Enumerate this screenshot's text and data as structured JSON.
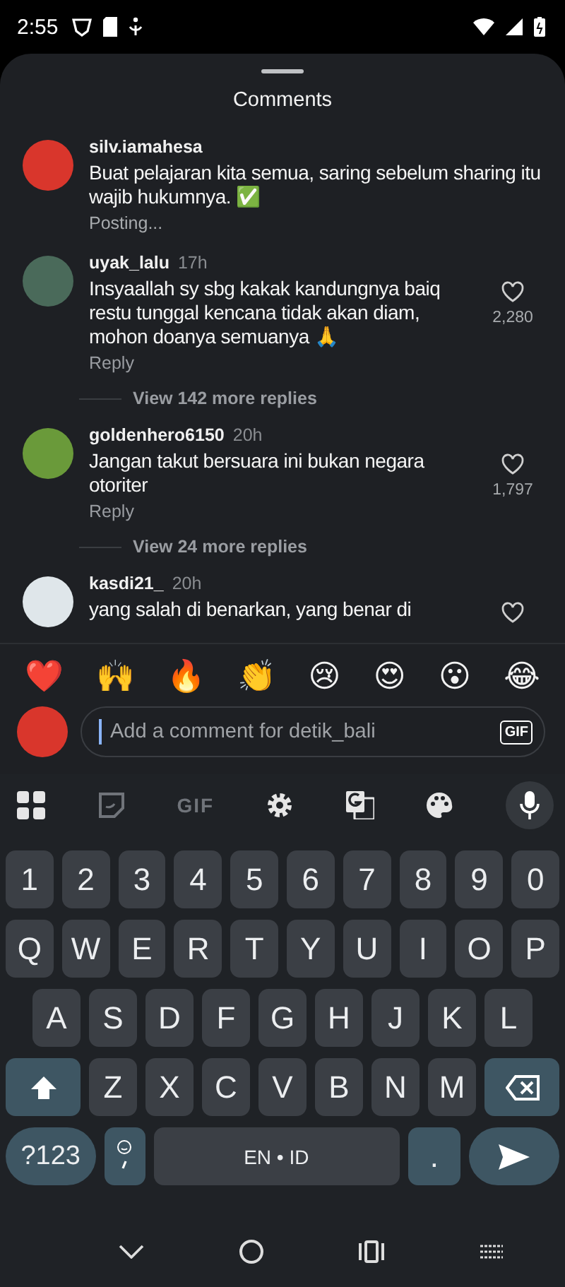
{
  "status_bar": {
    "time": "2:55"
  },
  "sheet": {
    "title": "Comments"
  },
  "comments": [
    {
      "user": "silv.iamahesa",
      "text": "Buat pelajaran kita semua, saring sebelum sharing itu wajib hukumnya. ✅",
      "footer": "Posting...",
      "kind": "pending"
    },
    {
      "user": "uyak_lalu",
      "time": "17h",
      "text": "Insyaallah sy sbg kakak kandungnya baiq restu tunggal kencana tidak akan diam, mohon doanya semuanya 🙏",
      "footer": "Reply",
      "likes": "2,280",
      "more_replies": "View 142 more replies",
      "kind": "posted"
    },
    {
      "user": "goldenhero6150",
      "time": "20h",
      "text": "Jangan takut bersuara ini bukan negara otoriter",
      "footer": "Reply",
      "likes": "1,797",
      "more_replies": "View 24 more replies",
      "kind": "posted"
    },
    {
      "user": "kasdi21_",
      "time": "20h",
      "text": "yang salah di benarkan, yang benar di",
      "kind": "posted"
    }
  ],
  "reactions": [
    "❤️",
    "🙌",
    "🔥",
    "👏",
    "😢",
    "😍",
    "😮",
    "😂"
  ],
  "composer": {
    "placeholder": "Add a comment for detik_bali",
    "gif_label": "GIF"
  },
  "keyboard_toolbar": {
    "gif_label": "GIF"
  },
  "keyboard": [
    [
      {
        "label": "1",
        "kind": "char"
      },
      {
        "label": "2",
        "kind": "char"
      },
      {
        "label": "3",
        "kind": "char"
      },
      {
        "label": "4",
        "kind": "char"
      },
      {
        "label": "5",
        "kind": "char"
      },
      {
        "label": "6",
        "kind": "char"
      },
      {
        "label": "7",
        "kind": "char"
      },
      {
        "label": "8",
        "kind": "char"
      },
      {
        "label": "9",
        "kind": "char"
      },
      {
        "label": "0",
        "kind": "char"
      }
    ],
    [
      {
        "label": "Q",
        "kind": "char"
      },
      {
        "label": "W",
        "kind": "char"
      },
      {
        "label": "E",
        "kind": "char"
      },
      {
        "label": "R",
        "kind": "char"
      },
      {
        "label": "T",
        "kind": "char"
      },
      {
        "label": "Y",
        "kind": "char"
      },
      {
        "label": "U",
        "kind": "char"
      },
      {
        "label": "I",
        "kind": "char"
      },
      {
        "label": "O",
        "kind": "char"
      },
      {
        "label": "P",
        "kind": "char"
      }
    ],
    [
      {
        "label": "A",
        "kind": "char"
      },
      {
        "label": "S",
        "kind": "char"
      },
      {
        "label": "D",
        "kind": "char"
      },
      {
        "label": "F",
        "kind": "char"
      },
      {
        "label": "G",
        "kind": "char"
      },
      {
        "label": "H",
        "kind": "char"
      },
      {
        "label": "J",
        "kind": "char"
      },
      {
        "label": "K",
        "kind": "char"
      },
      {
        "label": "L",
        "kind": "char"
      }
    ],
    [
      {
        "kind": "shift"
      },
      {
        "label": "Z",
        "kind": "char"
      },
      {
        "label": "X",
        "kind": "char"
      },
      {
        "label": "C",
        "kind": "char"
      },
      {
        "label": "V",
        "kind": "char"
      },
      {
        "label": "B",
        "kind": "char"
      },
      {
        "label": "N",
        "kind": "char"
      },
      {
        "label": "M",
        "kind": "char"
      },
      {
        "kind": "backspace"
      }
    ],
    [
      {
        "label": "?123",
        "kind": "symbols"
      },
      {
        "kind": "emoji"
      },
      {
        "label": "EN • ID",
        "kind": "space"
      },
      {
        "label": ".",
        "kind": "period"
      },
      {
        "kind": "send"
      }
    ]
  ]
}
